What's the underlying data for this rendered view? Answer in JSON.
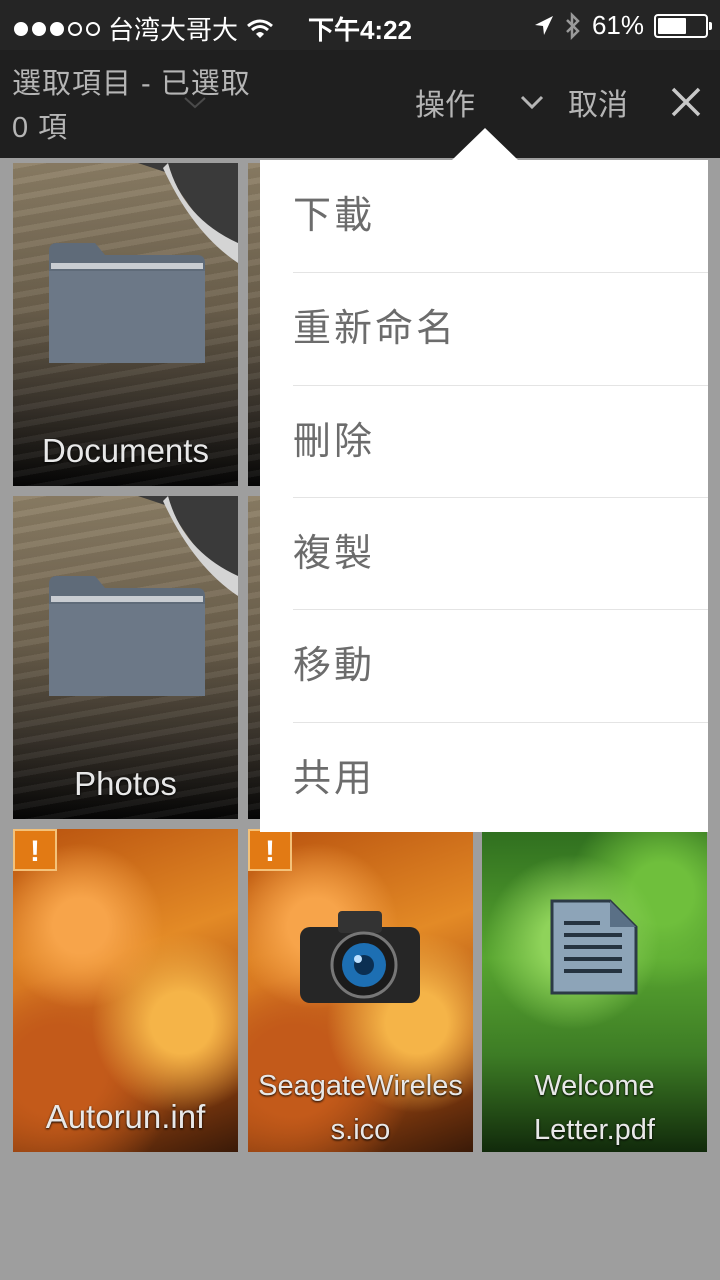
{
  "status_bar": {
    "carrier": "台湾大哥大",
    "time": "下午4:22",
    "battery": "61%",
    "battery_level": 0.61,
    "signal_bars_filled": 3,
    "signal_bars_total": 5
  },
  "toolbar": {
    "selection_title": "選取項目 - 已選取 0 項",
    "operations_label": "操作",
    "cancel_label": "取消"
  },
  "menu": {
    "items": [
      "下載",
      "重新命名",
      "刪除",
      "複製",
      "移動",
      "共用"
    ]
  },
  "files": [
    {
      "name": "Documents",
      "type": "folder"
    },
    {
      "name": "Photos",
      "type": "folder"
    },
    {
      "name": "Autorun.inf",
      "type": "file",
      "warning": "!"
    },
    {
      "name": "SeagateWireless.ico",
      "type": "image",
      "warning": "!"
    },
    {
      "name": "Welcome Letter.pdf",
      "type": "pdf"
    }
  ],
  "colors": {
    "toolbar_bg": "#1f1f1f",
    "warning": "#e27a14",
    "menu_text": "#6c6c6c"
  }
}
